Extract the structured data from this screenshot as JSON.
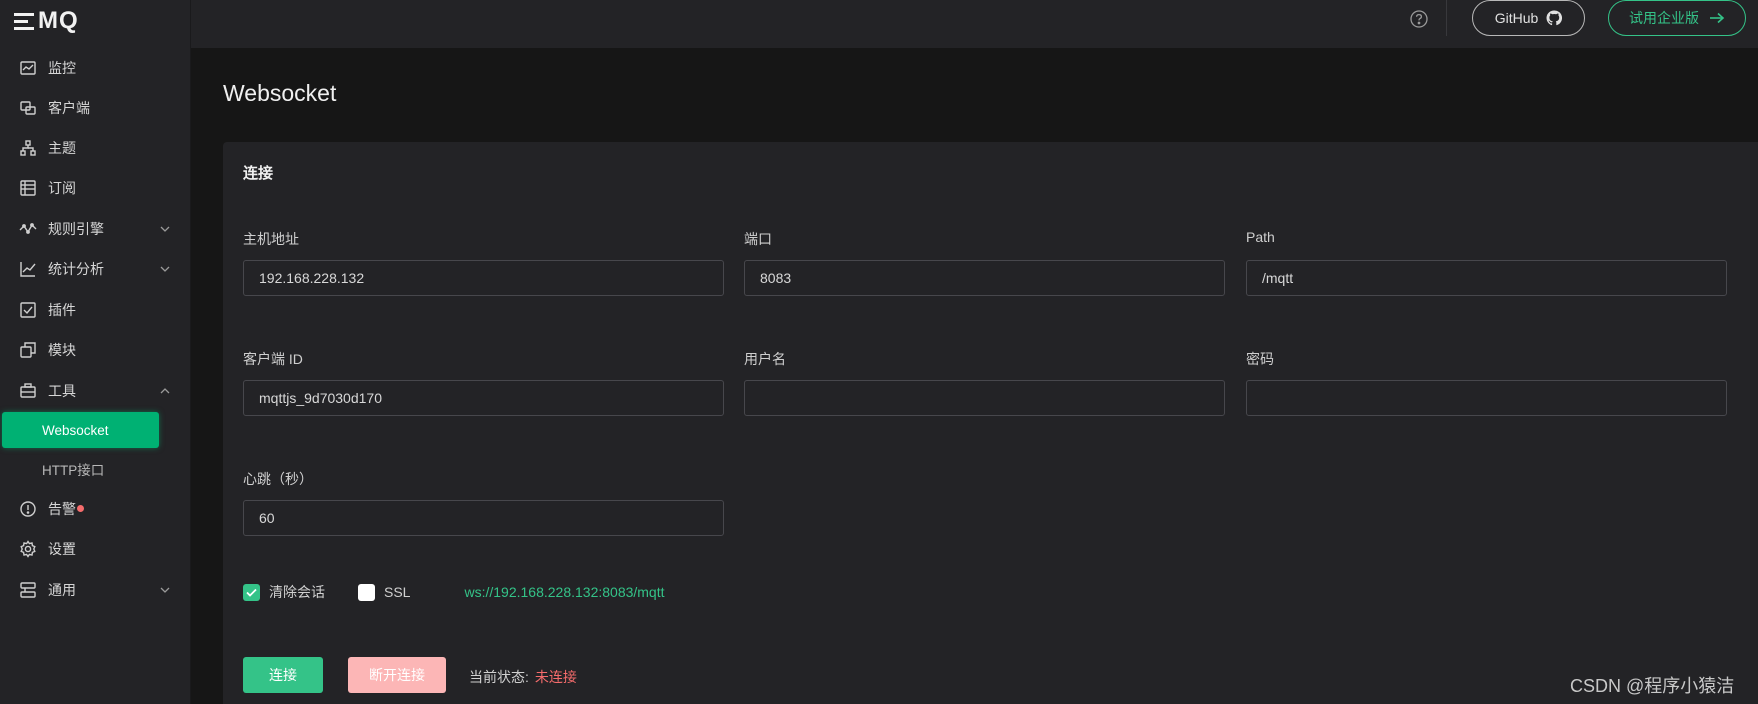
{
  "logo": {
    "text": "MQ"
  },
  "sidebar": {
    "items": [
      {
        "label": "监控",
        "icon": "monitor-icon"
      },
      {
        "label": "客户端",
        "icon": "clients-icon"
      },
      {
        "label": "主题",
        "icon": "topics-icon"
      },
      {
        "label": "订阅",
        "icon": "subscriptions-icon"
      },
      {
        "label": "规则引擎",
        "icon": "rule-engine-icon",
        "expandable": true
      },
      {
        "label": "统计分析",
        "icon": "analytics-icon",
        "expandable": true
      },
      {
        "label": "插件",
        "icon": "plugins-icon"
      },
      {
        "label": "模块",
        "icon": "modules-icon"
      },
      {
        "label": "工具",
        "icon": "tools-icon",
        "expanded": true
      },
      {
        "label": "告警",
        "icon": "alarm-icon"
      },
      {
        "label": "设置",
        "icon": "settings-icon"
      },
      {
        "label": "通用",
        "icon": "general-icon",
        "expandable": true
      }
    ],
    "tools_sub": [
      {
        "label": "Websocket",
        "active": true
      },
      {
        "label": "HTTP接口"
      }
    ]
  },
  "header": {
    "github_label": "GitHub",
    "trial_label": "试用企业版"
  },
  "page": {
    "title": "Websocket",
    "card_title": "连接"
  },
  "form": {
    "host": {
      "label": "主机地址",
      "value": "192.168.228.132"
    },
    "port": {
      "label": "端口",
      "value": "8083"
    },
    "path": {
      "label": "Path",
      "value": "/mqtt"
    },
    "client_id": {
      "label": "客户端 ID",
      "value": "mqttjs_9d7030d170"
    },
    "username": {
      "label": "用户名",
      "value": ""
    },
    "password": {
      "label": "密码",
      "value": ""
    },
    "keepalive": {
      "label": "心跳（秒）",
      "value": "60"
    },
    "clean_session": {
      "label": "清除会话",
      "checked": true
    },
    "ssl": {
      "label": "SSL",
      "checked": false
    },
    "url": "ws://192.168.228.132:8083/mqtt"
  },
  "actions": {
    "connect_label": "连接",
    "disconnect_label": "断开连接",
    "status_label": "当前状态:",
    "status_value": "未连接"
  },
  "watermark": "CSDN @程序小猿洁",
  "colors": {
    "accent": "#34c388",
    "active_menu": "#00b173",
    "danger": "#f56c6c",
    "disconnect_bg": "#fcb6b6"
  }
}
